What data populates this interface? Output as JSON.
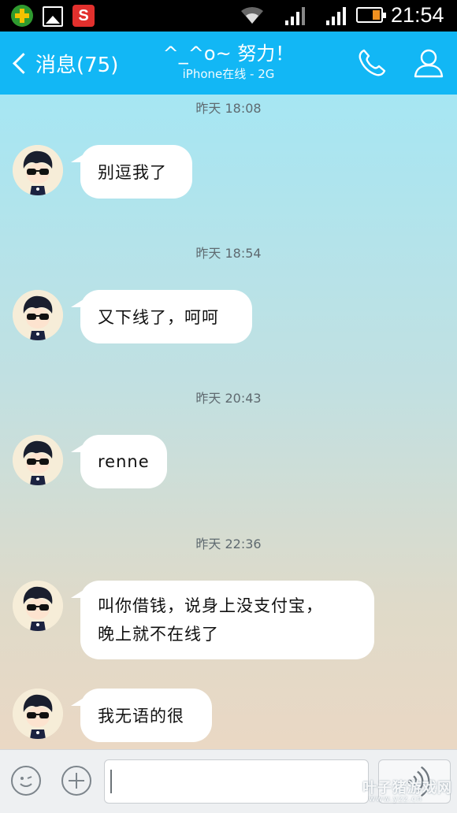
{
  "status_bar": {
    "time": "21:54",
    "battery_level": 0.35
  },
  "header": {
    "back_label": "消息(75)",
    "title": "^_^o~ 努力！",
    "subtitle": "iPhone在线 - 2G"
  },
  "messages": [
    {
      "timestamp": "昨天 18:08",
      "text": "别逗我了"
    },
    {
      "timestamp": "昨天 18:54",
      "text": "又下线了，呵呵"
    },
    {
      "timestamp": "昨天 20:43",
      "text": "renne"
    },
    {
      "timestamp": "昨天 22:36",
      "line1": "叫你借钱，说身上没支付宝，",
      "line2": "晚上就不在线了"
    },
    {
      "text": "我无语的很"
    }
  ],
  "input": {
    "value": ""
  },
  "watermark": {
    "brand": "叶子猪游戏网",
    "domain": "www.yzz.cn"
  },
  "colors": {
    "header": "#12b7f5",
    "bubble": "#ffffff"
  }
}
